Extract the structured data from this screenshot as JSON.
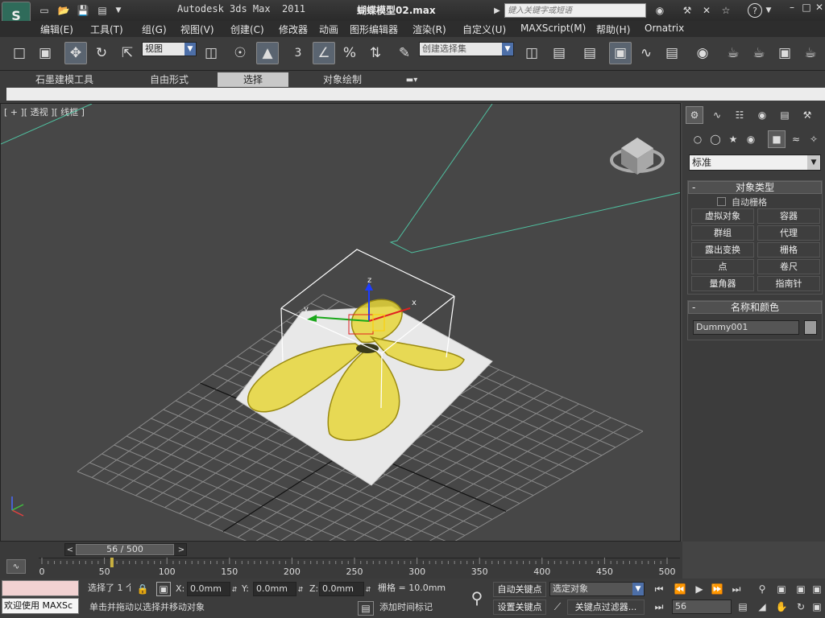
{
  "app": {
    "product": "Autodesk 3ds Max  2011",
    "filename": "蝴蝶模型02.max",
    "search_placeholder": "键入关键字或短语"
  },
  "menu": [
    "编辑(E)",
    "工具(T)",
    "组(G)",
    "视图(V)",
    "创建(C)",
    "修改器",
    "动画",
    "图形编辑器",
    "渲染(R)",
    "自定义(U)",
    "MAXScript(M)",
    "帮助(H)",
    "Ornatrix"
  ],
  "toolbar": {
    "ref_coord": "视图",
    "snap_number": "3",
    "selection_set": "创建选择集"
  },
  "ribbon": {
    "tabs": [
      "石墨建模工具",
      "自由形式",
      "选择",
      "对象绘制"
    ],
    "active_tab": "选择"
  },
  "viewport": {
    "label": "[ + ][ 透视 ][ 线框 ]"
  },
  "command_panel": {
    "category": "标准",
    "object_type_title": "对象类型",
    "auto_grid": "自动栅格",
    "buttons": [
      [
        "虚拟对象",
        "容器"
      ],
      [
        "群组",
        "代理"
      ],
      [
        "露出变换",
        "栅格"
      ],
      [
        "点",
        "卷尺"
      ],
      [
        "量角器",
        "指南针"
      ]
    ],
    "name_color_title": "名称和颜色",
    "object_name": "Dummy001",
    "object_color": "#9a9a9a"
  },
  "timeline": {
    "slider": "56 / 500",
    "current_frame": 56,
    "total_frames": 500,
    "ticks": [
      "0",
      "50",
      "100",
      "150",
      "200",
      "250",
      "300",
      "350",
      "400",
      "450",
      "500"
    ]
  },
  "status": {
    "selected": "选择了 1 个",
    "x_label": "X:",
    "x_val": "0.0mm",
    "y_label": "Y:",
    "y_val": "0.0mm",
    "z_label": "Z:",
    "z_val": "0.0mm",
    "grid": "栅格 = 10.0mm",
    "auto_key": "自动关键点",
    "set_key": "设置关键点",
    "key_mode": "选定对象",
    "key_filter": "关键点过滤器...",
    "add_time_tag": "添加时间标记",
    "welcome": "欢迎使用 MAXSc",
    "prompt": "单击并拖动以选择并移动对象",
    "frame_field": "56"
  }
}
